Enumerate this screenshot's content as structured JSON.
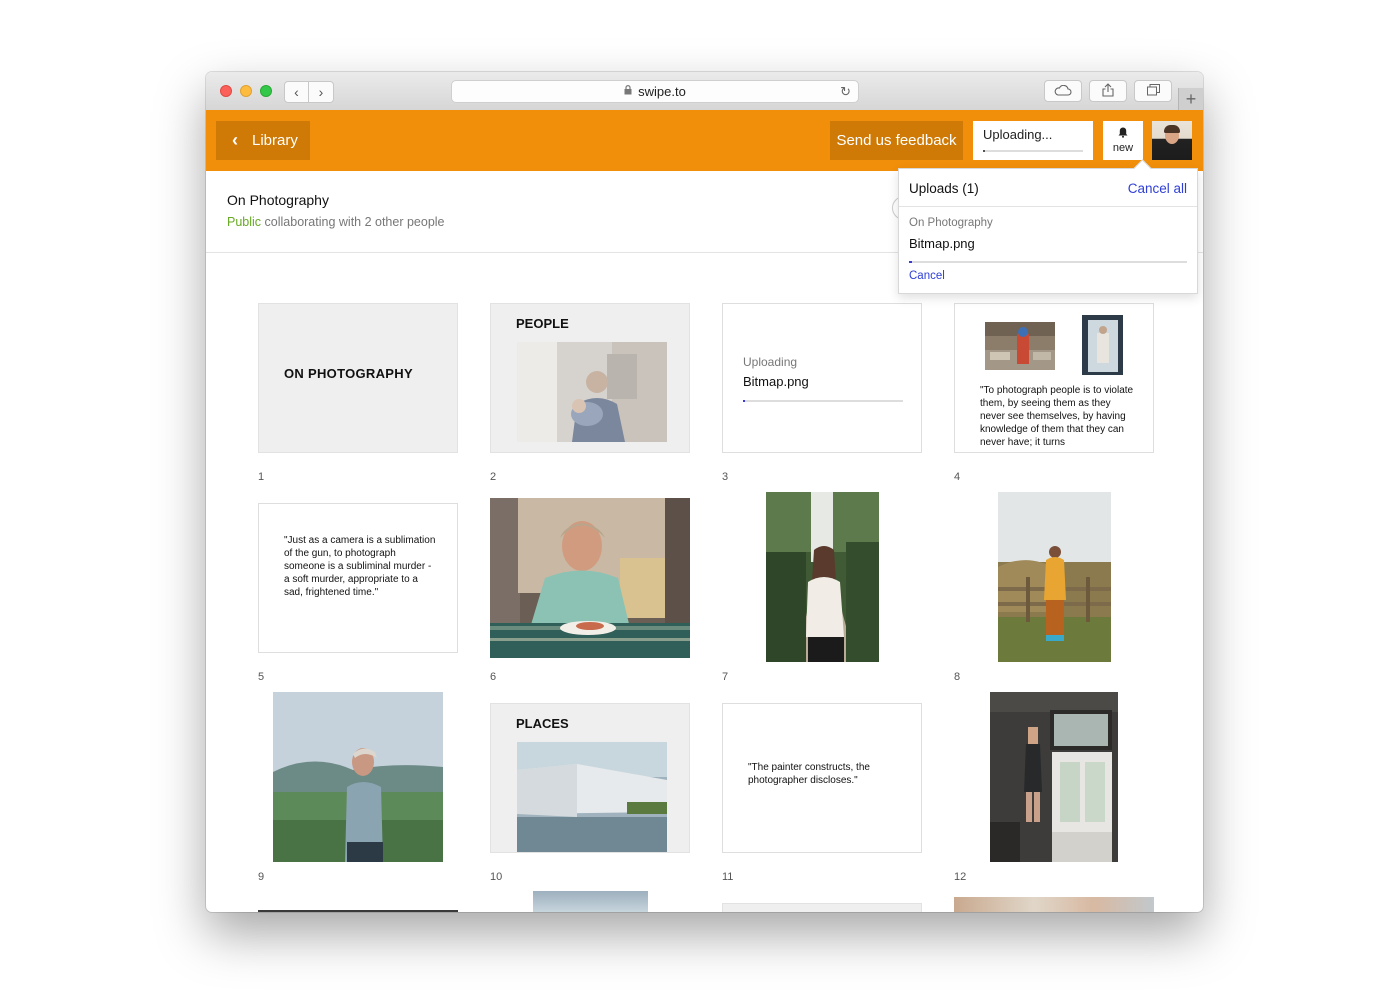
{
  "browser": {
    "url": "swipe.to"
  },
  "header": {
    "library_label": "Library",
    "feedback_label": "Send us feedback",
    "upload_status": "Uploading...",
    "upload_progress": 0.02,
    "notifications_label": "new"
  },
  "document": {
    "title": "On Photography",
    "visibility": "Public",
    "collab_text": "collaborating with 2 other people"
  },
  "uploads_popover": {
    "title": "Uploads (1)",
    "cancel_all": "Cancel all",
    "item_document": "On Photography",
    "item_file": "Bitmap.png",
    "item_progress": 0.01,
    "item_cancel": "Cancel"
  },
  "slides": [
    {
      "number": "1",
      "kind": "title",
      "text": "ON PHOTOGRAPHY"
    },
    {
      "number": "2",
      "kind": "section",
      "text": "PEOPLE",
      "image": "man-holding-baby-photo"
    },
    {
      "number": "3",
      "kind": "uploading",
      "status": "Uploading",
      "file": "Bitmap.png",
      "progress": 0.01
    },
    {
      "number": "4",
      "kind": "images-quote",
      "images": [
        "market-woman-photo",
        "doorway-figure-photo"
      ],
      "text": "\"To photograph people is to violate them, by seeing them as they never see themselves, by having knowledge of them that they can never have; it turns"
    },
    {
      "number": "5",
      "kind": "quote",
      "text": "\"Just as a camera is a sublimation of the gun, to photograph someone is a subliminal murder - a soft murder, appropriate to a sad, frightened time.\""
    },
    {
      "number": "6",
      "kind": "photo",
      "image": "man-eating-photo"
    },
    {
      "number": "7",
      "kind": "photo",
      "image": "woman-forest-road-photo"
    },
    {
      "number": "8",
      "kind": "photo",
      "image": "woman-fence-camera-photo"
    },
    {
      "number": "9",
      "kind": "photo",
      "image": "old-man-hills-photo"
    },
    {
      "number": "10",
      "kind": "section",
      "text": "PLACES",
      "image": "white-wall-photo"
    },
    {
      "number": "11",
      "kind": "quote",
      "text": "\"The painter constructs, the photographer discloses.\""
    },
    {
      "number": "12",
      "kind": "photo",
      "image": "hanging-figure-door-photo"
    }
  ],
  "colors": {
    "accent": "#f18f0b",
    "accent_dark": "#cf7a06",
    "link": "#2f3fd6",
    "public": "#68a924"
  }
}
